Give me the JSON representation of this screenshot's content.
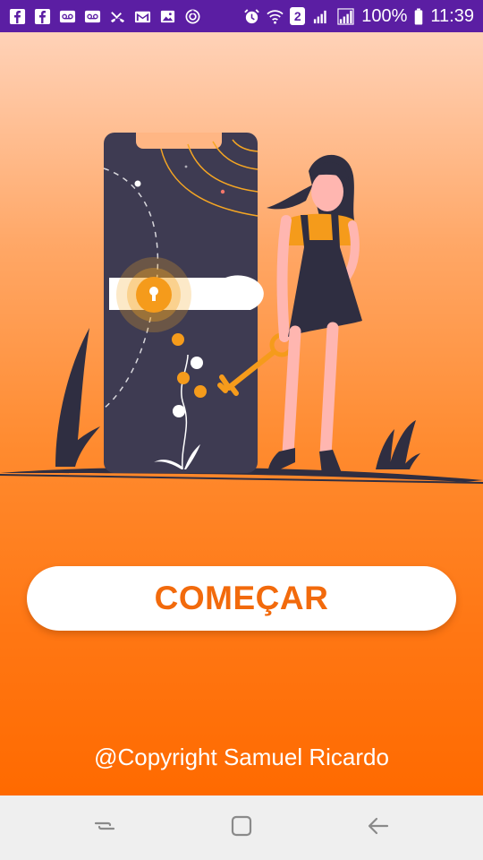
{
  "status_bar": {
    "notification_icons": [
      "facebook-icon",
      "facebook-icon",
      "voicemail-icon",
      "voicemail-icon",
      "missed-call-icon",
      "gmail-icon",
      "gallery-icon",
      "sync-icon"
    ],
    "system_icons": [
      "alarm-icon",
      "wifi-icon",
      "sim-2-icon",
      "signal-icon",
      "signal-icon"
    ],
    "sim_badge": "2",
    "battery": "100%",
    "time": "11:39",
    "background_color": "#5b1ea3"
  },
  "main": {
    "start_button_label": "COMEÇAR",
    "copyright": "@Copyright Samuel Ricardo",
    "accent_color": "#f26a0c",
    "gradient_top": "#ffd2b8",
    "gradient_bottom": "#ff6a00"
  },
  "nav_bar": {
    "buttons": [
      "recents-icon",
      "home-icon",
      "back-icon"
    ]
  }
}
